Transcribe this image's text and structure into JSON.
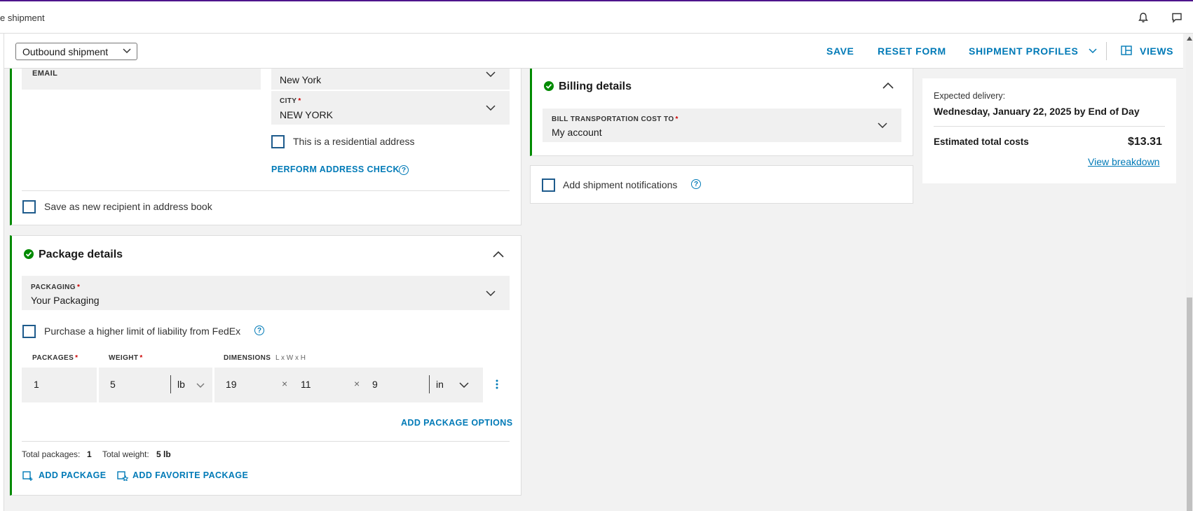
{
  "header": {
    "title": "e shipment",
    "bell_icon": "bell-icon",
    "feedback_icon": "chat-icon"
  },
  "toolbar": {
    "shipment_type": "Outbound shipment",
    "save": "SAVE",
    "reset": "RESET FORM",
    "profiles": "SHIPMENT PROFILES",
    "views": "VIEWS"
  },
  "recipient": {
    "email_label": "EMAIL",
    "state_value": "New York",
    "city_label": "CITY",
    "city_value": "NEW YORK",
    "residential": "This is a residential address",
    "address_check": "PERFORM ADDRESS CHECK",
    "save_recipient": "Save as new recipient in address book"
  },
  "package": {
    "title": "Package details",
    "packaging_label": "PACKAGING",
    "packaging_value": "Your Packaging",
    "liability": "Purchase a higher limit of liability from FedEx",
    "packages_label": "PACKAGES",
    "weight_label": "WEIGHT",
    "dimensions_label": "DIMENSIONS",
    "dimensions_hint": "L x W x H",
    "packages_value": "1",
    "weight_value": "5",
    "weight_unit": "lb",
    "length": "19",
    "width": "11",
    "height": "9",
    "dim_unit": "in",
    "times": "×",
    "add_options": "ADD PACKAGE OPTIONS",
    "total_packages_label": "Total packages:",
    "total_packages": "1",
    "total_weight_label": "Total weight:",
    "total_weight": "5 lb",
    "add_package": "ADD PACKAGE",
    "add_favorite": "ADD FAVORITE PACKAGE"
  },
  "billing": {
    "title": "Billing details",
    "bill_label": "BILL TRANSPORTATION COST TO",
    "bill_value": "My account"
  },
  "notifications": {
    "label": "Add shipment notifications"
  },
  "summary": {
    "expected_label": "Expected delivery:",
    "expected_value": "Wednesday, January 22, 2025 by End of Day",
    "total_label": "Estimated total costs",
    "total_value": "$13.31",
    "breakdown": "View breakdown"
  },
  "colors": {
    "accent": "#007ab7",
    "success": "#008a00",
    "brand": "#4d148c"
  }
}
